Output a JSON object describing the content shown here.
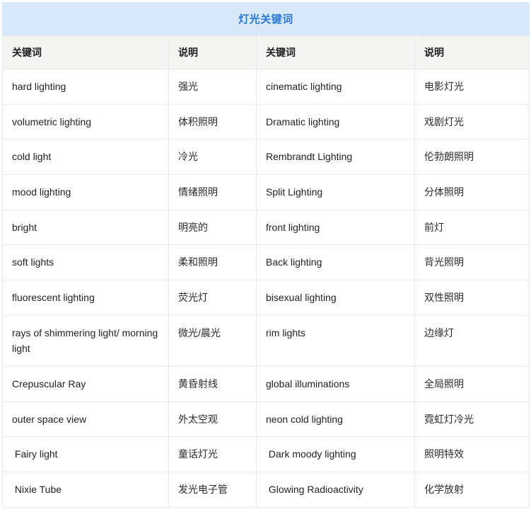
{
  "table": {
    "title": "灯光关键词",
    "columns": [
      "关键词",
      "说明",
      "关键词",
      "说明"
    ],
    "rows": [
      {
        "keyword_left": "hard lighting",
        "desc_left": "强光",
        "keyword_right": "cinematic lighting",
        "desc_right": "电影灯光"
      },
      {
        "keyword_left": "volumetric lighting",
        "desc_left": "体积照明",
        "keyword_right": "Dramatic lighting",
        "desc_right": "戏剧灯光"
      },
      {
        "keyword_left": "cold light",
        "desc_left": "冷光",
        "keyword_right": "Rembrandt Lighting",
        "desc_right": "伦勃朗照明"
      },
      {
        "keyword_left": "mood lighting",
        "desc_left": "情绪照明",
        "keyword_right": "Split Lighting",
        "desc_right": "分体照明"
      },
      {
        "keyword_left": "bright",
        "desc_left": "明亮的",
        "keyword_right": "front lighting",
        "desc_right": "前灯"
      },
      {
        "keyword_left": "soft lights",
        "desc_left": "柔和照明",
        "keyword_right": "Back lighting",
        "desc_right": "背光照明"
      },
      {
        "keyword_left": "fluorescent lighting",
        "desc_left": "荧光灯",
        "keyword_right": "bisexual lighting",
        "desc_right": "双性照明"
      },
      {
        "keyword_left": "rays of shimmering light/ morning light",
        "desc_left": "微光/晨光",
        "keyword_right": "rim lights",
        "desc_right": "边缘灯"
      },
      {
        "keyword_left": "Crepuscular Ray",
        "desc_left": "黄昏射线",
        "keyword_right": "global illuminations",
        "desc_right": "全局照明"
      },
      {
        "keyword_left": "outer space view",
        "desc_left": "外太空观",
        "keyword_right": "neon cold lighting",
        "desc_right": "霓虹灯冷光"
      },
      {
        "keyword_left": " Fairy light",
        "desc_left": "童话灯光",
        "keyword_right": " Dark moody lighting",
        "desc_right": "照明特效"
      },
      {
        "keyword_left": " Nixie Tube",
        "desc_left": "发光电子管",
        "keyword_right": " Glowing Radioactivity",
        "desc_right": "化学放射"
      }
    ]
  },
  "colors": {
    "title_bg": "#d9e8fb",
    "title_text": "#2979d4",
    "header_bg": "#f4f4f3",
    "border": "#e8e8e8",
    "body_text": "#222222"
  }
}
